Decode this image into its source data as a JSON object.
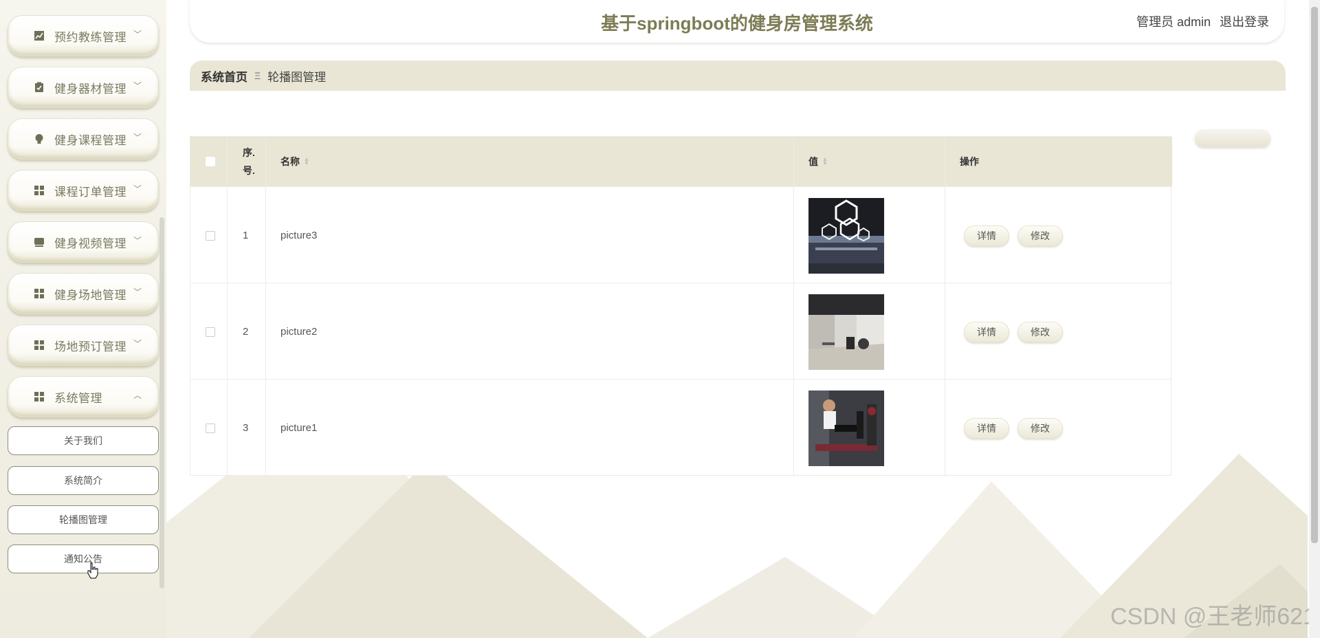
{
  "header": {
    "title": "基于springboot的健身房管理系统",
    "user_label": "管理员 admin",
    "logout_label": "退出登录"
  },
  "sidebar": {
    "items": [
      {
        "label": "预约教练管理",
        "icon": "chart-icon"
      },
      {
        "label": "健身器材管理",
        "icon": "clipboard-icon"
      },
      {
        "label": "健身课程管理",
        "icon": "bulb-icon"
      },
      {
        "label": "课程订单管理",
        "icon": "grid-icon"
      },
      {
        "label": "健身视频管理",
        "icon": "video-icon"
      },
      {
        "label": "健身场地管理",
        "icon": "grid-icon"
      },
      {
        "label": "场地预订管理",
        "icon": "grid-icon"
      },
      {
        "label": "系统管理",
        "icon": "grid-icon"
      }
    ],
    "sub_items": [
      "关于我们",
      "系统简介",
      "轮播图管理",
      "通知公告"
    ]
  },
  "breadcrumb": {
    "home": "系统首页",
    "separator": "Ξ",
    "current": "轮播图管理"
  },
  "table": {
    "headers": {
      "index": "序.号.",
      "name": "名称",
      "value": "值",
      "action": "操作"
    },
    "rows": [
      {
        "index": "1",
        "name": "picture3",
        "image": "gym-hexagon-lights"
      },
      {
        "index": "2",
        "name": "picture2",
        "image": "gym-interior"
      },
      {
        "index": "3",
        "name": "picture1",
        "image": "man-exercising"
      }
    ],
    "detail_label": "详情",
    "edit_label": "修改"
  },
  "watermark": "CSDN @王老师621",
  "colors": {
    "accent": "#7c7c55",
    "header_bg": "#e9e6d5",
    "sidebar_bg": "#f6f5ee"
  }
}
